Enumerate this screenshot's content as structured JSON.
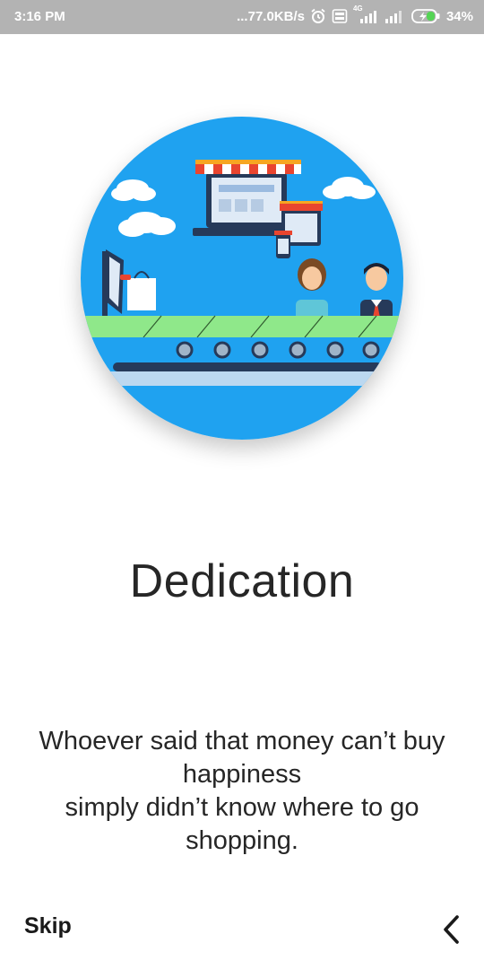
{
  "status_bar": {
    "time": "3:16 PM",
    "network_speed": "...77.0KB/s",
    "network_type": "4G",
    "battery_percent": "34%",
    "icons": [
      "alarm-icon",
      "volte-icon",
      "signal-4g-icon",
      "signal-icon",
      "battery-charging-icon"
    ]
  },
  "onboarding": {
    "illustration": "online-shopping-illustration",
    "title": "Dedication",
    "quote_lines": [
      "Whoever said that money can’t buy",
      "happiness",
      "simply didn’t know where to go",
      "shopping."
    ]
  },
  "navigation": {
    "skip_label": "Skip",
    "back_icon": "chevron-left-icon"
  },
  "colors": {
    "status_bar_bg": "#b3b3b3",
    "hero_blue": "#1fa2f0",
    "text_dark": "#262626",
    "conveyor_green": "#8fe88a"
  }
}
